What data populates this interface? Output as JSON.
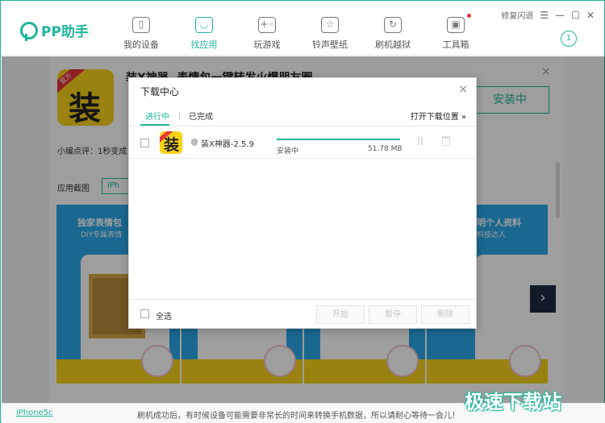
{
  "app": {
    "brand": "PP助手"
  },
  "nav": {
    "items": [
      {
        "label": "我的设备",
        "icon": "phone-icon",
        "glyph": "▯"
      },
      {
        "label": "找应用",
        "icon": "shopping-bag-icon",
        "glyph": "◡"
      },
      {
        "label": "玩游戏",
        "icon": "gamepad-icon",
        "glyph": "+◦"
      },
      {
        "label": "铃声壁纸",
        "icon": "star-icon",
        "glyph": "☆"
      },
      {
        "label": "刷机越狱",
        "icon": "refresh-icon",
        "glyph": "↻"
      },
      {
        "label": "工具箱",
        "icon": "toolbox-icon",
        "glyph": "▣"
      }
    ],
    "active_index": 1
  },
  "window": {
    "repair_crash": "修复闪退",
    "menu": "☰",
    "minimize": "—",
    "maximize": "☐",
    "close": "✕",
    "badge_count": "1"
  },
  "app_card": {
    "logo_ribbon": "官方",
    "logo_glyph": "装",
    "title": "装X神器 -表情包一键转发火爆朋友圈",
    "install_label": "安装中",
    "close": "×",
    "editor_note": "小编点评：1秒变成",
    "screenshots_label": "应用截图",
    "device_tab": "iPh",
    "shot_banner": "独家表情包",
    "shot_sub": "DIY专属表情",
    "shot_banner_right": "明个人资料",
    "shot_sub_right": "料技达人",
    "next_arrow": "›"
  },
  "dialog": {
    "title": "下载中心",
    "close": "×",
    "tab_active": "进行中",
    "tab_done": "已完成",
    "open_location": "打开下载位置 »",
    "item": {
      "name": "装X神器-2.5.9",
      "status": "安装中",
      "size": "51.78 MB",
      "progress": 1.0
    },
    "select_all": "全选",
    "start": "开始",
    "pause": "暂停",
    "delete": "删除"
  },
  "status": {
    "device": "iPhone5c",
    "tip": "刷机成功后，有时候设备可能需要非常长的时间来转换手机数据，所以请耐心等待一会儿！"
  },
  "watermark": "极速下载站",
  "colors": {
    "accent": "#1fb59c",
    "logo_yellow": "#f7d219",
    "red": "#e5343a"
  }
}
